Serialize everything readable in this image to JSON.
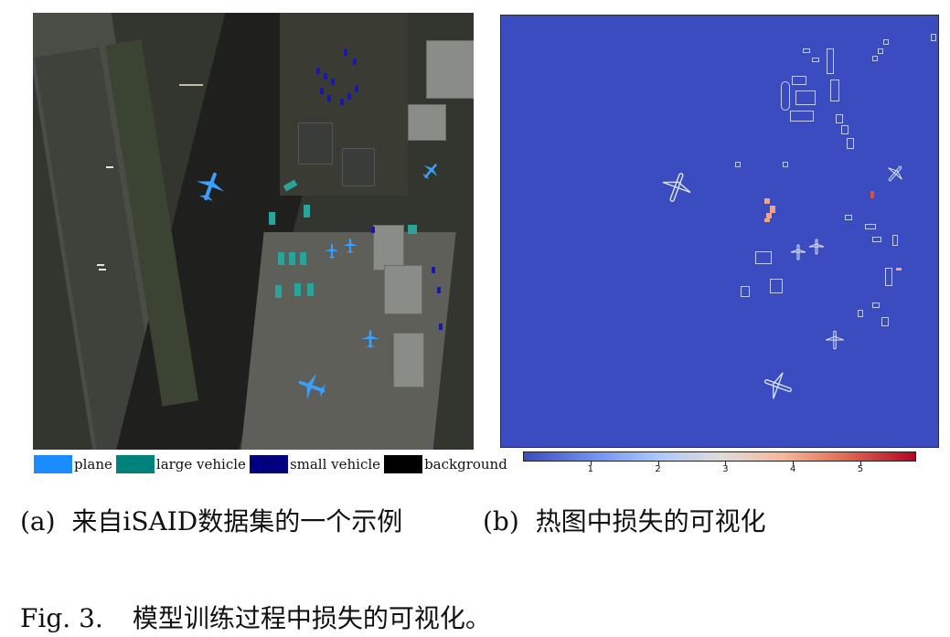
{
  "panel_a": {
    "legend": [
      {
        "label": "plane",
        "color": "#1a8cff"
      },
      {
        "label": "large vehicle",
        "color": "#00827a"
      },
      {
        "label": "small vehicle",
        "color": "#00007f"
      },
      {
        "label": "background",
        "color": "#000000"
      }
    ],
    "caption_tag": "(a)",
    "caption_text": "来自iSAID数据集的一个示例"
  },
  "panel_b": {
    "colorbar_ticks": [
      "1",
      "2",
      "3",
      "4",
      "5"
    ],
    "colorbar_colormap": "coolwarm",
    "caption_tag": "(b)",
    "caption_text": "热图中损失的可视化"
  },
  "figure": {
    "label": "Fig. 3.",
    "caption": "模型训练过程中损失的可视化。"
  },
  "colors": {
    "plane": "#1a8cff",
    "large_vehicle": "#00827a",
    "small_vehicle": "#00007f",
    "background": "#000000",
    "heat_low": "#3b4cc0",
    "heat_high": "#b40426"
  }
}
